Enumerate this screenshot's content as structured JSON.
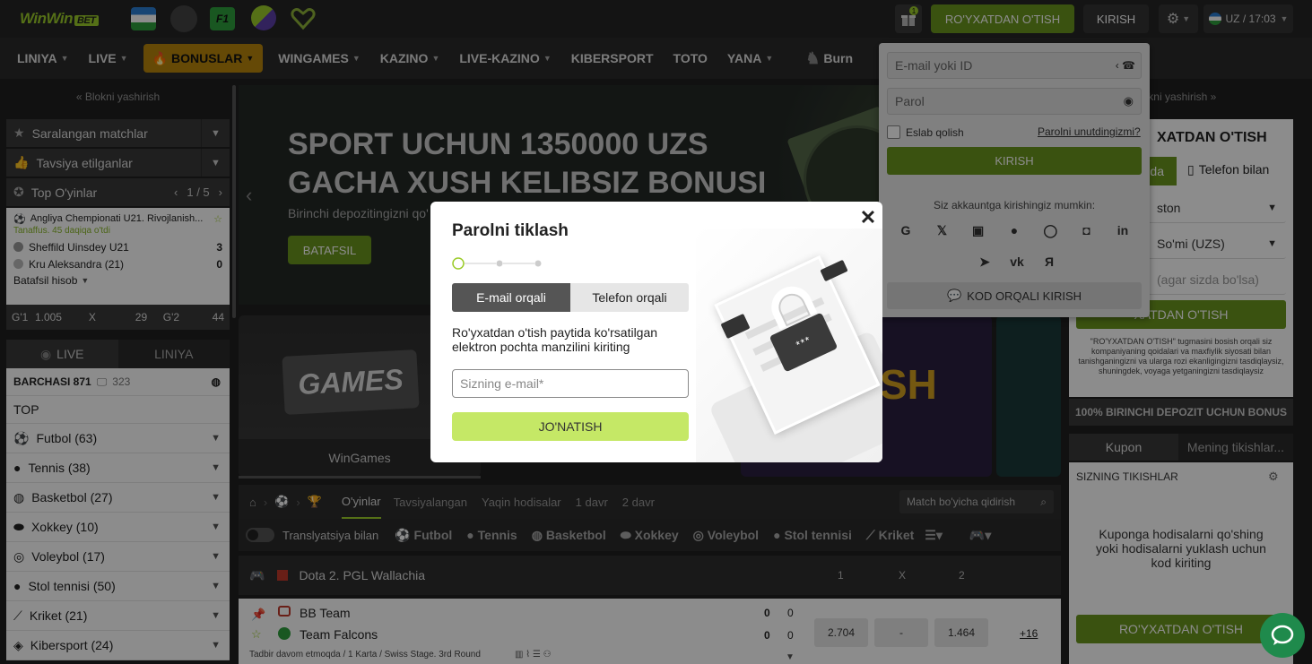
{
  "header": {
    "logo_main": "WinWin",
    "logo_badge": "BET",
    "register_label": "RO'YXATDAN O'TISH",
    "login_label": "KIRISH",
    "gift_badge": "1",
    "lang_label": "UZ / 17:03"
  },
  "nav": {
    "items": [
      "LINIYA",
      "LIVE",
      "BONUSLAR",
      "WINGAMES",
      "KAZINO",
      "LIVE-KAZINO",
      "KIBERSPORT",
      "TOTO",
      "YANA",
      "Burn"
    ]
  },
  "left": {
    "hide_label": "« Blokni yashirish",
    "rows": [
      "Saralangan matchlar",
      "Tavsiya etilganlar"
    ],
    "top_players": {
      "label": "Top O'yinlar",
      "pager": "1 / 5"
    },
    "match": {
      "league": "Angliya Chempionati U21. Rivojlanish...",
      "status": "Tanaffus. 45 daqiqa o'tdi",
      "team1": "Sheffild Uinsdey U21",
      "score1": "3",
      "team2": "Kru Aleksandra (21)",
      "score2": "0",
      "more": "Batafsil hisob",
      "odds": [
        "G'1",
        "1.005",
        "X",
        "29",
        "G'2",
        "44"
      ]
    },
    "tabs": [
      "LIVE",
      "LINIYA"
    ],
    "all_label": "BARCHASI 871",
    "all_count": "323",
    "top_label": "TOP",
    "sports": [
      "Futbol (63)",
      "Tennis (38)",
      "Basketbol (27)",
      "Xokkey (10)",
      "Voleybol (17)",
      "Stol tennisi (50)",
      "Kriket (21)",
      "Kibersport (24)"
    ]
  },
  "banner": {
    "title": "SPORT UCHUN 1350000 UZS GACHA XUSH KELIBSIZ BONUSI",
    "subtitle": "Birinchi depozitingizni qo'",
    "more_label": "BATAFSIL"
  },
  "tiles": {
    "games_word": "GAMES",
    "wingames_label": "WinGames",
    "ash_word": "SH"
  },
  "filters": {
    "tabs": [
      "O'yinlar",
      "Tavsiyalangan",
      "Yaqin hodisalar",
      "1 davr",
      "2 davr"
    ],
    "search_placeholder": "Match bo'yicha qidirish"
  },
  "sportbar": {
    "toggle_label": "Translyatsiya bilan",
    "sports": [
      "Futbol",
      "Tennis",
      "Basketbol",
      "Xokkey",
      "Voleybol",
      "Stol tennisi",
      "Kriket"
    ]
  },
  "event": {
    "league": "Dota 2. PGL Wallachia",
    "cols": [
      "1",
      "X",
      "2"
    ],
    "team1": "BB Team",
    "team2": "Team Falcons",
    "scores1": [
      "0",
      "0"
    ],
    "scores2": [
      "0",
      "0"
    ],
    "odds": [
      "2.704",
      "-",
      "1.464"
    ],
    "more": "+16",
    "status": "Tadbir davom etmoqda / 1 Karta / Swiss Stage. 3rd Round"
  },
  "right": {
    "hide_label": "ikni yashirish »",
    "reg_title": "XATDAN O'TISH",
    "tab_partial": "da",
    "tab_phone": "Telefon bilan",
    "country": "ston",
    "currency": "So'mi (UZS)",
    "promo": "(agar sizda bo'lsa)",
    "reg_button": "XATDAN O'TISH",
    "terms": "\"RO'YXATDAN O'TISH\" tugmasini bosish orqali siz kompaniyaning qoidalari va maxfiylik siyosati bilan tanishganingizni va ularga rozi ekanligingizni tasdiqlaysiz, shuningdek, voyaga yetganingizni tasdiqlaysiz",
    "bonus_label": "100% BIRINCHI DEPOZIT UCHUN BONUS",
    "coupon_tabs": [
      "Kupon",
      "Mening tikishlar..."
    ],
    "bets_label": "SIZNING TIKISHLAR",
    "coupon_text": "Kuponga hodisalarni qo'shing yoki hodisalarni yuklash uchun kod kiriting",
    "coupon_reg": "RO'YXATDAN O'TISH"
  },
  "login": {
    "email_placeholder": "E-mail yoki ID",
    "password_placeholder": "Parol",
    "remember": "Eslab qolish",
    "forgot": "Parolni unutdingizmi?",
    "login_button": "KIRISH",
    "social_text": "Siz akkauntga kirishingiz mumkin:",
    "code_login": "KOD ORQALI KIRISH"
  },
  "modal": {
    "title": "Parolni tiklash",
    "tab_email": "E-mail orqali",
    "tab_phone": "Telefon orqali",
    "description": "Ro'yxatdan o'tish paytida ko'rsatilgan elektron pochta manzilini kiriting",
    "email_placeholder": "Sizning e-mail*",
    "send_label": "JO'NATISH",
    "close": "✕",
    "lock_text": "***"
  },
  "colors": {
    "accent_green": "#6b961e",
    "light_green": "#c5e866",
    "bonus_gold": "#b8860b"
  }
}
